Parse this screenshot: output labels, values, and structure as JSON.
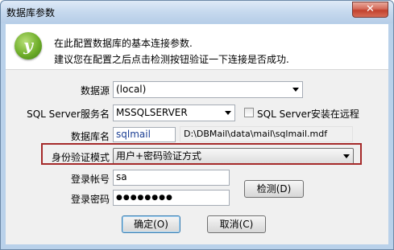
{
  "window": {
    "title": "数据库参数",
    "close_glyph": "✕"
  },
  "header": {
    "logo_glyph": "y",
    "line1": "在此配置数据库的基本连接参数.",
    "line2": "建议您在配置之后点击检测按钮验证一下连接是否成功."
  },
  "form": {
    "datasource_label": "数据源",
    "datasource_value": "(local)",
    "servicename_label": "SQL Server服务名",
    "servicename_value": "MSSQLSERVER",
    "remote_label": "SQL Server安装在远程",
    "dbname_label": "数据库名",
    "dbname_value": "sqlmail",
    "dbpath_value": "D:\\DBMail\\data\\mail\\sqlmail.mdf",
    "auth_label": "身份验证模式",
    "auth_value": "用户+密码验证方式",
    "login_label": "登录帐号",
    "login_value": "sa",
    "password_label": "登录密码",
    "password_value": "●●●●●●●●"
  },
  "buttons": {
    "test": "检测(D)",
    "ok": "确定(O)",
    "cancel": "取消(C)"
  }
}
